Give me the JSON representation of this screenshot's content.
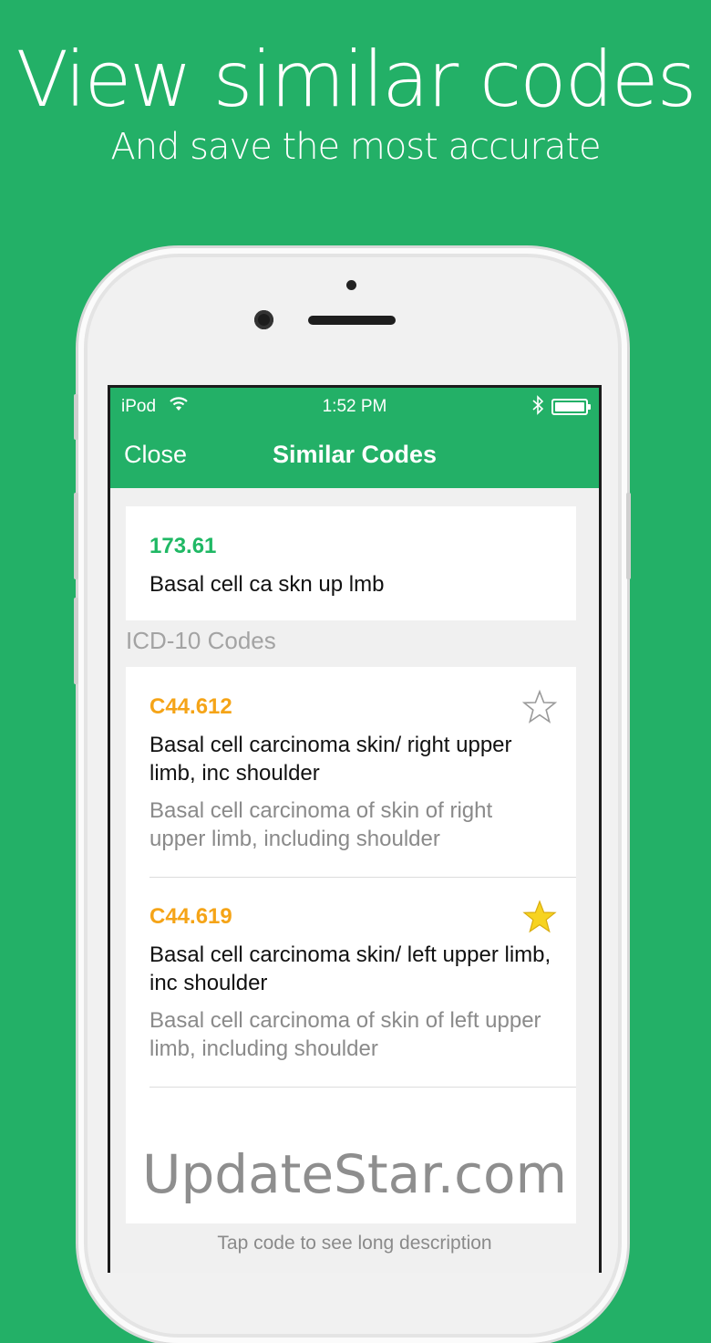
{
  "promo": {
    "headline": "View similar codes",
    "subline": "And save the most accurate"
  },
  "status_bar": {
    "carrier": "iPod",
    "time": "1:52 PM"
  },
  "navbar": {
    "close_label": "Close",
    "title": "Similar Codes"
  },
  "source_code": {
    "code": "173.61",
    "short_description": "Basal cell ca skn up lmb"
  },
  "section": {
    "header": "ICD-10 Codes"
  },
  "codes": [
    {
      "code": "C44.612",
      "short_description": "Basal cell carcinoma skin/ right upper limb, inc shoulder",
      "long_description": "Basal cell carcinoma of skin of right upper limb, including shoulder",
      "favorited": false
    },
    {
      "code": "C44.619",
      "short_description": "Basal cell carcinoma skin/ left upper limb, inc shoulder",
      "long_description": "Basal cell carcinoma of skin of left upper limb, including shoulder",
      "favorited": true
    }
  ],
  "watermark": "UpdateStar.com",
  "footer_hint": "Tap code to see long description",
  "colors": {
    "brand_green": "#23b067",
    "code_green": "#1fb864",
    "code_orange": "#f5a417",
    "star_gold": "#f7d320"
  }
}
